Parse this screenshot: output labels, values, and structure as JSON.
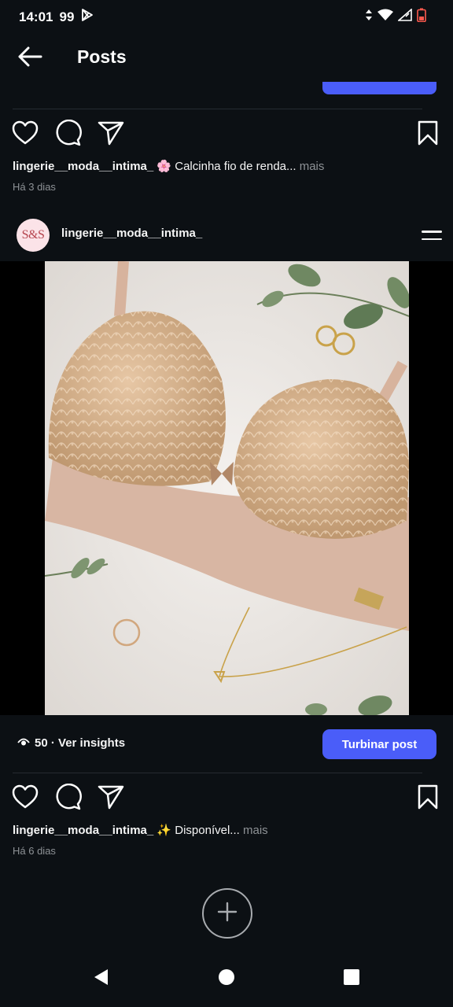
{
  "status_bar": {
    "time": "14:01",
    "notification_count": "99"
  },
  "header": {
    "title": "Posts"
  },
  "post_prev": {
    "username": "lingerie__moda__intima_",
    "caption": " 🌸 Calcinha fio de renda...",
    "more": " mais",
    "timestamp": "Há 3 dias"
  },
  "post_main": {
    "avatar_text": "S&S",
    "username": "lingerie__moda__intima_",
    "views": "50",
    "insights_label": " · Ver insights",
    "boost_label": "Turbinar post"
  },
  "post_next": {
    "username": "lingerie__moda__intima_",
    "caption": " ✨ Disponível...",
    "more": " mais",
    "timestamp": "Há 6 dias"
  },
  "colors": {
    "background": "#0c1014",
    "accent": "#4a5df9",
    "muted_text": "#8e9296"
  },
  "icons": [
    "back-arrow",
    "heart",
    "comment",
    "share",
    "bookmark",
    "options",
    "eye",
    "plus",
    "nav-back",
    "nav-home",
    "nav-recents"
  ]
}
